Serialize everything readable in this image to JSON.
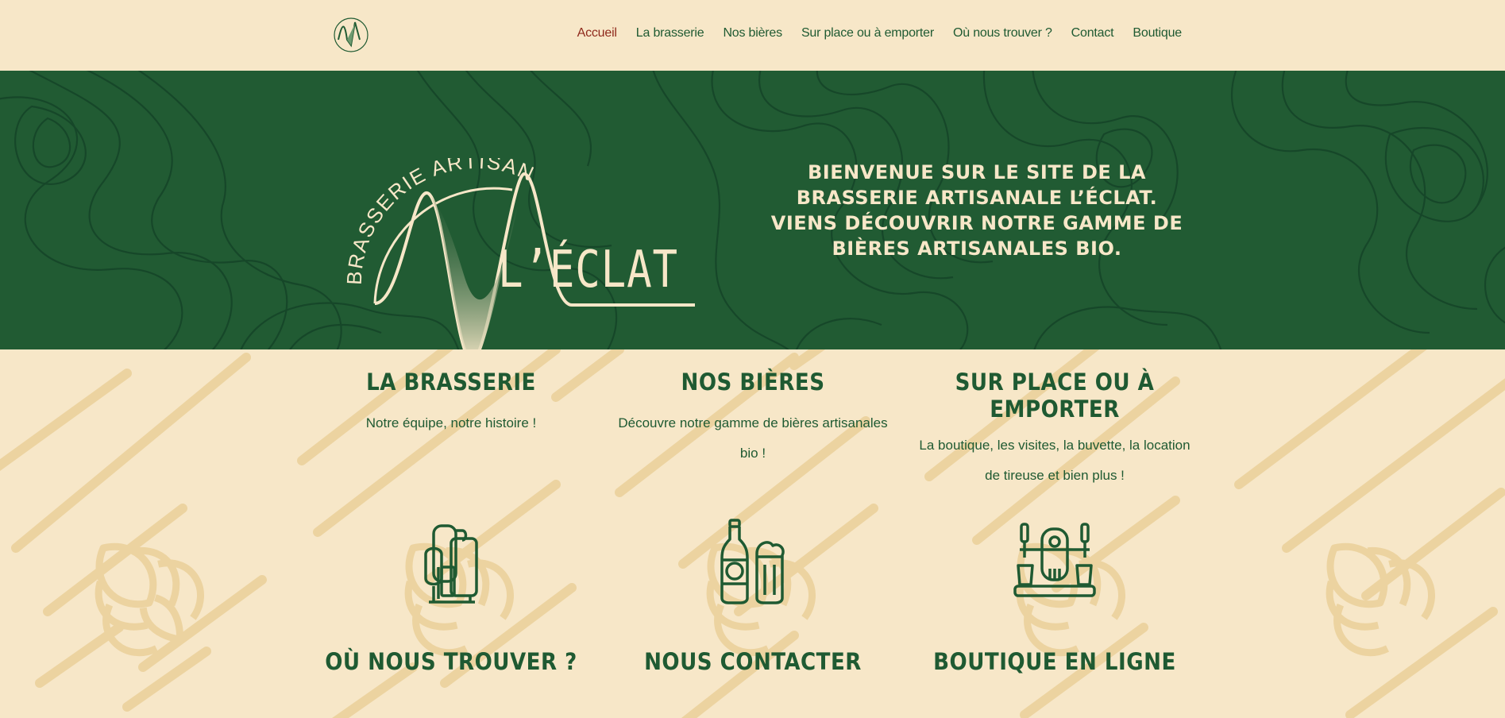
{
  "nav": {
    "items": [
      {
        "label": "Accueil",
        "active": true
      },
      {
        "label": "La brasserie",
        "active": false
      },
      {
        "label": "Nos bières",
        "active": false
      },
      {
        "label": "Sur place ou à emporter",
        "active": false
      },
      {
        "label": "Où nous trouver ?",
        "active": false
      },
      {
        "label": "Contact",
        "active": false
      },
      {
        "label": "Boutique",
        "active": false
      }
    ]
  },
  "hero": {
    "logo_arc_text": "BRASSERIE ARTISANALE",
    "brand": "L’ÉCLAT",
    "tagline": "Bienvenue sur le site de la brasserie artisanale L’éclat. Viens découvrir notre gamme de bières artisanales bio."
  },
  "cards": [
    {
      "title": "La brasserie",
      "text": "Notre équipe, notre histoire !",
      "icon": "brewery-tanks-icon"
    },
    {
      "title": "Nos bières",
      "text": "Découvre notre gamme de bières artisanales bio !",
      "icon": "beer-bottle-glass-icon"
    },
    {
      "title": "Sur place ou à emporter",
      "text": "La boutique, les visites, la buvette, la location de tireuse et bien plus !",
      "icon": "beer-tap-icon"
    },
    {
      "title": "Où nous trouver ?",
      "text": "",
      "icon": ""
    },
    {
      "title": "Nous contacter",
      "text": "",
      "icon": ""
    },
    {
      "title": "Boutique en ligne",
      "text": "",
      "icon": ""
    }
  ],
  "colors": {
    "cream": "#f7e7c8",
    "green": "#215b33",
    "accent_red": "#8f2a1c",
    "hop_pattern": "#ecd3a0"
  }
}
